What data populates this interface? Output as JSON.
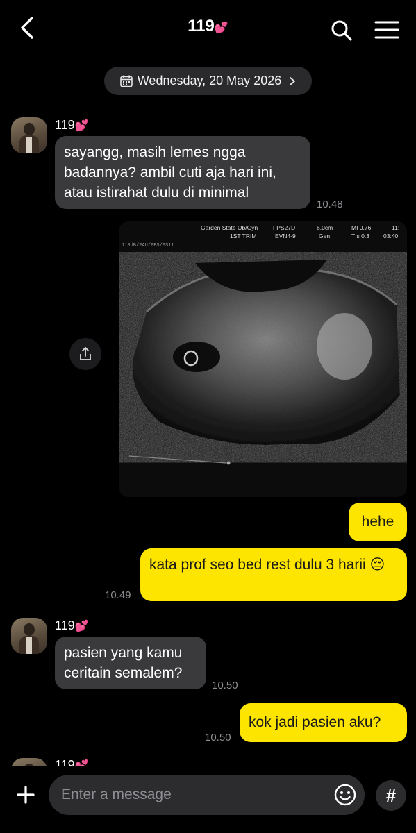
{
  "header": {
    "title": "119",
    "title_emoji": "💕"
  },
  "date_divider": {
    "label": "Wednesday, 20 May 2026"
  },
  "messages": [
    {
      "sender": "119",
      "sender_emoji": "💕",
      "text": "sayangg, masih lemes ngga badannya? ambil cuti aja hari ini, atau istirahat dulu di minimal",
      "time": "10.48"
    },
    {
      "type": "image",
      "ultrasound_text": {
        "line1a": "Garden State Ob/Gyn",
        "line1b": "FPS27D",
        "line1c": "6.0cm",
        "line1d": "MI 0.76",
        "line1e": "11:",
        "line2a": "1ST TRIM",
        "line2b": "EVN4-9",
        "line2c": "Gen.",
        "line2d": "TIs 0.3",
        "line2e": "03:40:",
        "side": "118dB/FAU/PBS/FS11"
      }
    },
    {
      "text": "hehe"
    },
    {
      "text": "kata prof seo bed rest dulu 3 harii 😔",
      "time": "10.49"
    },
    {
      "sender": "119",
      "sender_emoji": "💕",
      "text": "pasien yang kamu ceritain semalem?",
      "time": "10.50"
    },
    {
      "text": "kok jadi pasien aku?",
      "time": "10.50"
    },
    {
      "sender": "119",
      "sender_emoji": "💕"
    }
  ],
  "composer": {
    "placeholder": "Enter a message",
    "hash_label": "#"
  },
  "colors": {
    "background": "#000000",
    "incoming_bubble": "#3a3a3c",
    "outgoing_bubble": "#fee500",
    "timestamp": "#8e8e93"
  }
}
